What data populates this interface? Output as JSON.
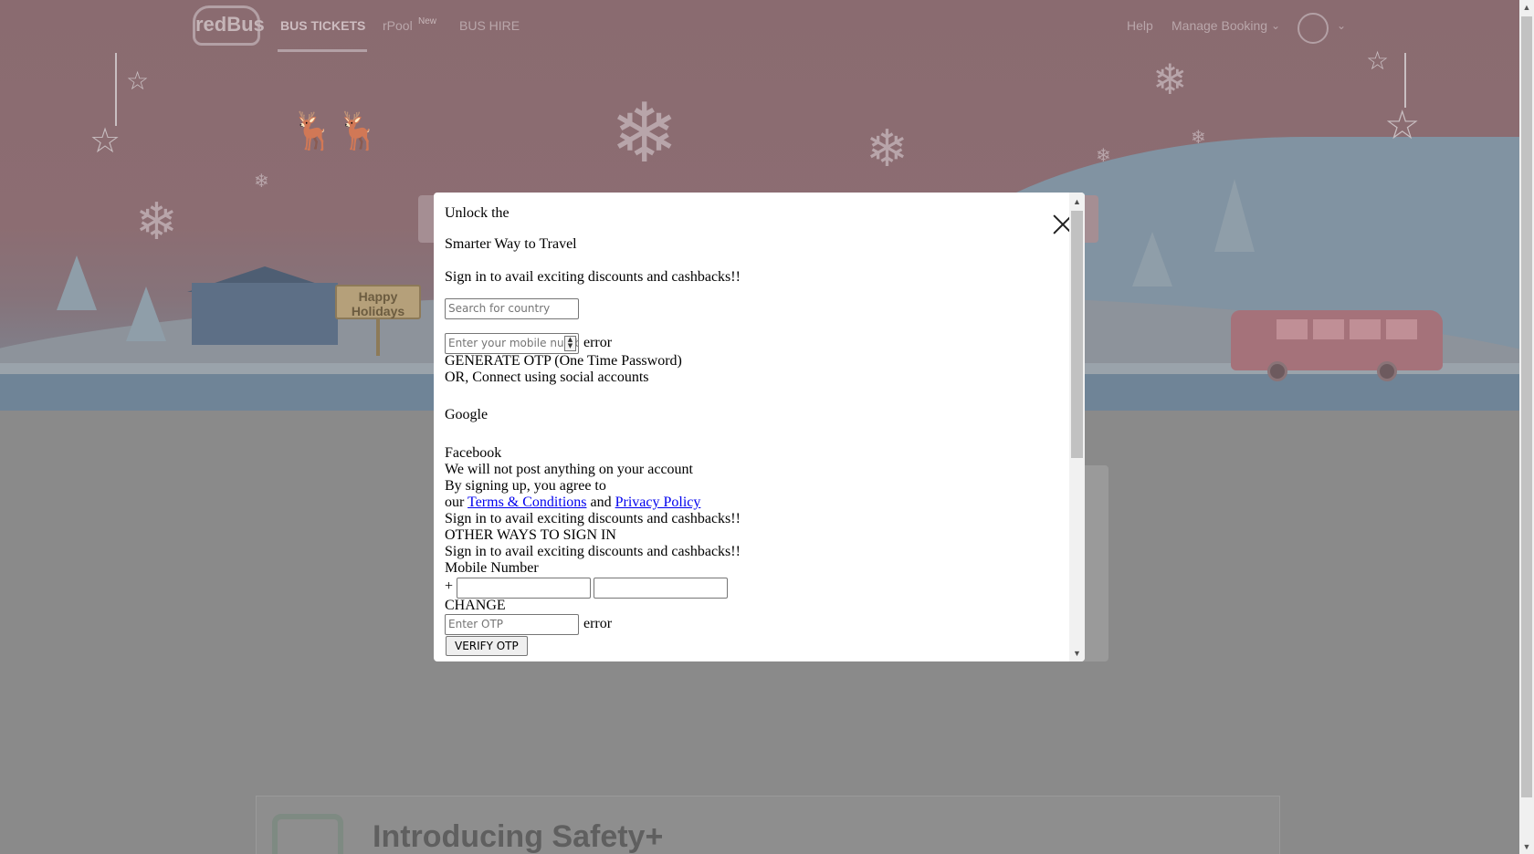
{
  "header": {
    "logo_text": "redBus",
    "nav": {
      "bus_tickets": "BUS TICKETS",
      "rpool": "rPool",
      "rpool_badge": "New",
      "bus_hire": "BUS HIRE"
    },
    "help": "Help",
    "manage_booking": "Manage Booking"
  },
  "hero": {
    "sign_text": "Happy Holidays"
  },
  "safety": {
    "title": "Introducing Safety+"
  },
  "modal": {
    "heading_line1": "Unlock the",
    "heading_line2": "Smarter Way to Travel",
    "subtitle": "Sign in to avail exciting discounts and cashbacks!!",
    "country_placeholder": "Search for country",
    "mobile_placeholder": "Enter your mobile number",
    "error_text": "error",
    "generate_otp": "GENERATE OTP (One Time Password)",
    "or_connect": "OR, Connect using social accounts",
    "google": "Google",
    "facebook": "Facebook",
    "no_post": "We will not post anything on your account",
    "agree_line": "By signing up, you agree to",
    "our": "our",
    "terms_link": "Terms & Conditions",
    "and": "and",
    "privacy_link": "Privacy Policy",
    "subtitle_repeat": "Sign in to avail exciting discounts and cashbacks!!",
    "other_ways": "OTHER WAYS TO SIGN IN",
    "subtitle_repeat_2": "Sign in to avail exciting discounts and cashbacks!!",
    "mobile_number_label": "Mobile Number",
    "plus_sign": "+",
    "change": "CHANGE",
    "otp_placeholder": "Enter OTP",
    "otp_error": "error",
    "verify_otp": "VERIFY OTP"
  }
}
